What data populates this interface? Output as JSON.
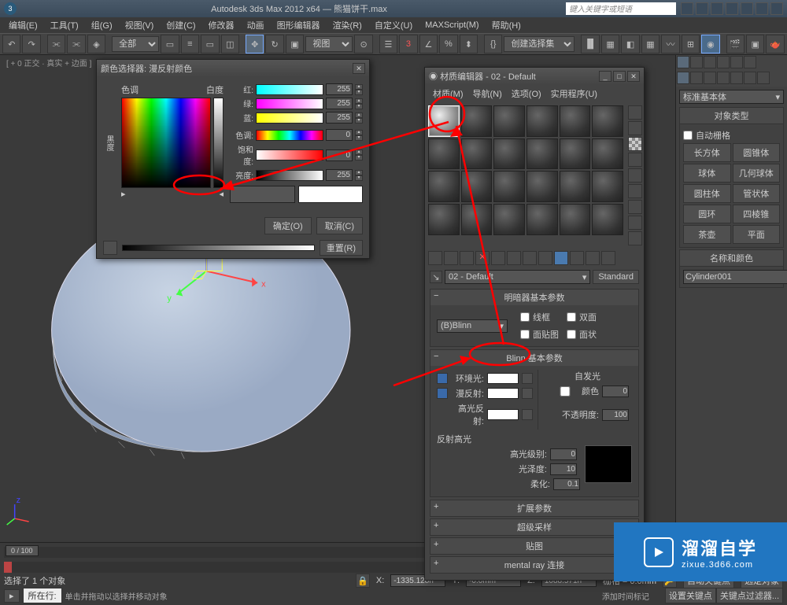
{
  "app": {
    "title": "Autodesk 3ds Max 2012 x64 — 熊猫饼干.max",
    "search_placeholder": "键入关键字或短语"
  },
  "menu": [
    "编辑(E)",
    "工具(T)",
    "组(G)",
    "视图(V)",
    "创建(C)",
    "修改器",
    "动画",
    "图形编辑器",
    "渲染(R)",
    "自定义(U)",
    "MAXScript(M)",
    "帮助(H)"
  ],
  "toolbar": {
    "filter": "全部",
    "view": "视图",
    "selset": "创建选择集"
  },
  "viewport": {
    "label": "[ + 0 正交 · 真实 + 边面 ]"
  },
  "colorpicker": {
    "title": "颜色选择器: 漫反射颜色",
    "hue": "色调",
    "white": "白度",
    "black": "黑度",
    "red": "红:",
    "green": "绿:",
    "blue": "蓝:",
    "hue2": "色调:",
    "sat": "饱和度:",
    "val": "亮度:",
    "r": "255",
    "g": "255",
    "b": "255",
    "h": "0",
    "s": "0",
    "v": "255",
    "ok": "确定(O)",
    "cancel": "取消(C)",
    "reset": "重置(R)"
  },
  "matedit": {
    "title": "材质编辑器 - 02 - Default",
    "menu": [
      "材质(M)",
      "导航(N)",
      "选项(O)",
      "实用程序(U)"
    ],
    "name": "02 - Default",
    "type_btn": "Standard",
    "r_shader": "明暗器基本参数",
    "shader": "(B)Blinn",
    "opts": {
      "wire": "线框",
      "twoSided": "双面",
      "faceMap": "面贴图",
      "faceted": "面状"
    },
    "r_blinn": "Blinn 基本参数",
    "ambient": "环境光:",
    "diffuse": "漫反射:",
    "specular": "高光反射:",
    "selfillum_hdr": "自发光",
    "selfillum": "颜色",
    "selfillum_val": "0",
    "opacity": "不透明度:",
    "opacity_val": "100",
    "spec_hdr": "反射高光",
    "spec_level": "高光级别:",
    "spec_level_val": "0",
    "gloss": "光泽度:",
    "gloss_val": "10",
    "soften": "柔化:",
    "soften_val": "0.1",
    "rollouts": [
      "扩展参数",
      "超级采样",
      "贴图",
      "mental ray 连接"
    ]
  },
  "cmdpanel": {
    "category": "标准基本体",
    "r_objtype": "对象类型",
    "autogrid": "自动栅格",
    "prims": [
      "长方体",
      "圆锥体",
      "球体",
      "几何球体",
      "圆柱体",
      "管状体",
      "圆环",
      "四棱锥",
      "茶壶",
      "平面"
    ],
    "r_name": "名称和颜色",
    "obj_name": "Cylinder001"
  },
  "status": {
    "sel": "选择了 1 个对象",
    "x": "-1335.128n",
    "y": "-0.0mm",
    "z": "1088.571n",
    "grid": "栅格 = 0.0mm",
    "autokey": "自动关键点",
    "selkey": "选定对象",
    "setkey": "设置关键点",
    "keyfilter": "关键点过滤器...",
    "prompt": "单击并拖动以选择并移动对象",
    "addtime": "添加时间标记",
    "slider": "0 / 100",
    "locbtn": "所在行:"
  },
  "watermark": {
    "big": "溜溜自学",
    "small": "zixue.3d66.com"
  }
}
